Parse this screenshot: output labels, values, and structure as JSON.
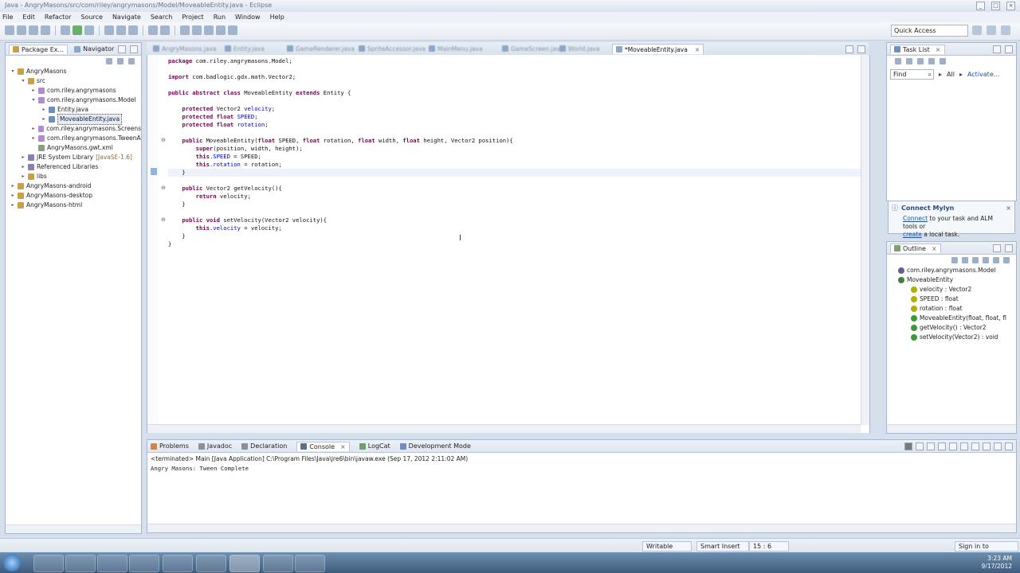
{
  "window": {
    "title": "Java - AngryMasons/src/com/riley/angrymasons/Model/MoveableEntity.java - Eclipse"
  },
  "menu": [
    "File",
    "Edit",
    "Refactor",
    "Source",
    "Navigate",
    "Search",
    "Project",
    "Run",
    "Window",
    "Help"
  ],
  "quick_access": "Quick Access",
  "left_panel": {
    "tabs": [
      "Package Ex...",
      "Navigator"
    ],
    "tree": [
      {
        "label": "AngryMasons",
        "level": 0,
        "toggle": "▾"
      },
      {
        "label": "src",
        "level": 1,
        "toggle": "▾"
      },
      {
        "label": "com.riley.angrymasons",
        "level": 2,
        "toggle": "▸"
      },
      {
        "label": "com.riley.angrymasons.Model",
        "level": 2,
        "toggle": "▾"
      },
      {
        "label": "Entity.java",
        "level": 3,
        "toggle": "▸"
      },
      {
        "label": "MoveableEntity.java",
        "level": 3,
        "toggle": "▸",
        "selected": true
      },
      {
        "label": "com.riley.angrymasons.Screens",
        "level": 2,
        "toggle": "▸"
      },
      {
        "label": "com.riley.angrymasons.TweenA",
        "level": 2,
        "toggle": "▸"
      },
      {
        "label": "AngryMasons.gwt.xml",
        "level": 2,
        "toggle": ""
      },
      {
        "label": "JRE System Library",
        "suffix": "[JavaSE-1.6]",
        "level": 1,
        "toggle": "▸"
      },
      {
        "label": "Referenced Libraries",
        "level": 1,
        "toggle": "▸"
      },
      {
        "label": "libs",
        "level": 1,
        "toggle": "▸"
      },
      {
        "label": "AngryMasons-android",
        "level": 0,
        "toggle": "▸"
      },
      {
        "label": "AngryMasons-desktop",
        "level": 0,
        "toggle": "▸"
      },
      {
        "label": "AngryMasons-html",
        "level": 0,
        "toggle": "▸"
      }
    ]
  },
  "editor": {
    "tabs": [
      "AngryMasons.java",
      "Entity.java",
      "GameRenderer.java",
      "SpriteAccessor.java",
      "MainMenu.java",
      "GameScreen.java",
      "World.java",
      "*MoveableEntity.java"
    ],
    "active_tab": "*MoveableEntity.java",
    "code_lines": [
      "package com.riley.angrymasons.Model;",
      "",
      "import com.badlogic.gdx.math.Vector2;",
      "",
      "public abstract class MoveableEntity extends Entity {",
      "",
      "    protected Vector2 velocity;",
      "    protected float SPEED;",
      "    protected float rotation;",
      "",
      "    public MoveableEntity(float SPEED, float rotation, float width, float height, Vector2 position){",
      "        super(position, width, height);",
      "        this.SPEED = SPEED;",
      "        this.rotation = rotation;",
      "    }",
      "",
      "    public Vector2 getVelocity(){",
      "        return velocity;",
      "    }",
      "",
      "    public void setVelocity(Vector2 velocity){",
      "        this.velocity = velocity;",
      "    }",
      "}"
    ],
    "current_line": 15,
    "fold_markers": [
      11,
      17,
      21
    ]
  },
  "task_list": {
    "tab": "Task List",
    "find_placeholder": "Find",
    "filter_all": "All",
    "activate": "Activate..."
  },
  "mylyn": {
    "title": "Connect Mylyn",
    "link_connect": "Connect",
    "text1": " to your task and ALM tools or",
    "link_create": "create",
    "text2": " a local task."
  },
  "outline": {
    "tab": "Outline",
    "items": [
      {
        "label": "com.riley.angrymasons.Model",
        "level": 0,
        "color": "#6b5b95"
      },
      {
        "label": "MoveableEntity",
        "level": 0,
        "color": "#3f7f3f"
      },
      {
        "label": "velocity : Vector2",
        "level": 1,
        "color": "#b0b000"
      },
      {
        "label": "SPEED : float",
        "level": 1,
        "color": "#b0b000"
      },
      {
        "label": "rotation : float",
        "level": 1,
        "color": "#b0b000"
      },
      {
        "label": "MoveableEntity(float, float, fl",
        "level": 1,
        "color": "#3a9a3a"
      },
      {
        "label": "getVelocity() : Vector2",
        "level": 1,
        "color": "#3a9a3a"
      },
      {
        "label": "setVelocity(Vector2) : void",
        "level": 1,
        "color": "#3a9a3a"
      }
    ]
  },
  "bottom_panel": {
    "tabs": [
      "Problems",
      "Javadoc",
      "Declaration",
      "Console",
      "LogCat",
      "Development Mode"
    ],
    "active_tab": "Console",
    "terminated": "<terminated> Main [Java Application] C:\\Program Files\\Java\\jre6\\bin\\javaw.exe (Sep 17, 2012 2:11:02 AM)",
    "output": "Angry Masons: Tween Complete"
  },
  "status_bar": {
    "writable": "Writable",
    "insert_mode": "Smart Insert",
    "position": "15 : 6",
    "sign_in": "Sign in to Google..."
  },
  "taskbar": {
    "time": "3:23 AM",
    "date": "9/17/2012"
  }
}
